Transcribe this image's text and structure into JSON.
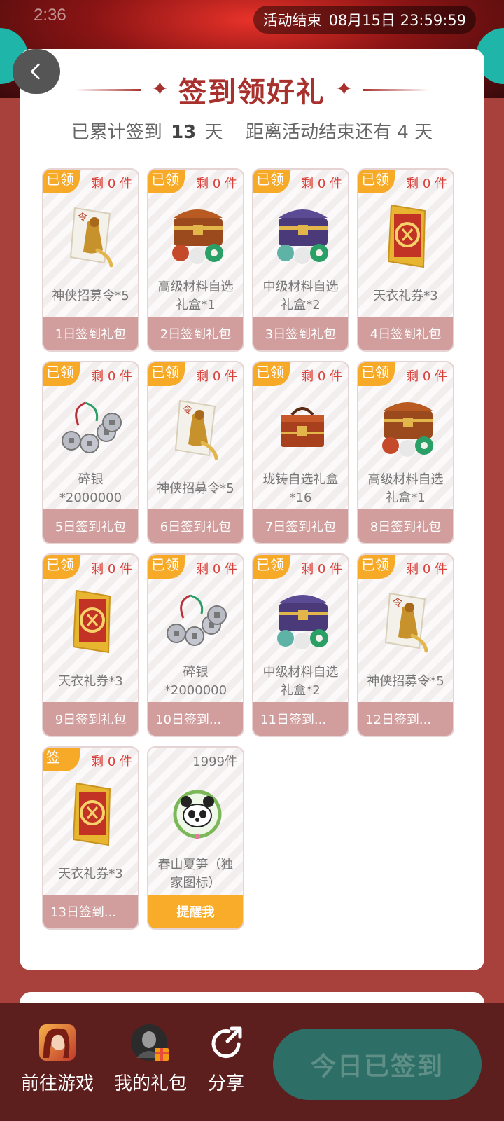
{
  "status_bar": {
    "time": "2:36"
  },
  "event_end": {
    "label": "活动结束",
    "datetime": "08月15日 23:59:59"
  },
  "header": {
    "title": "签到领好礼",
    "subtitle_prefix": "已累计签到",
    "signed_days": "13",
    "days_unit": "天",
    "remaining_prefix": "距离活动结束还有",
    "remaining_days": "4",
    "remaining_unit": "天"
  },
  "tiles": [
    {
      "corner": "已领",
      "remain": "剩 0 件",
      "name": "神侠招募令*5",
      "footer": "1日签到礼包",
      "icon": "token-icon"
    },
    {
      "corner": "已领",
      "remain": "剩 0 件",
      "name": "高级材料自选礼盒*1",
      "footer": "2日签到礼包",
      "icon": "chest-icon"
    },
    {
      "corner": "已领",
      "remain": "剩 0 件",
      "name": "中级材料自选礼盒*2",
      "footer": "3日签到礼包",
      "icon": "chest-purple-icon"
    },
    {
      "corner": "已领",
      "remain": "剩 0 件",
      "name": "天衣礼券*3",
      "footer": "4日签到礼包",
      "icon": "coupon-icon"
    },
    {
      "corner": "已领",
      "remain": "剩 0 件",
      "name": "碎银*2000000",
      "footer": "5日签到礼包",
      "icon": "coins-icon"
    },
    {
      "corner": "已领",
      "remain": "剩 0 件",
      "name": "神侠招募令*5",
      "footer": "6日签到礼包",
      "icon": "token-icon"
    },
    {
      "corner": "已领",
      "remain": "剩 0 件",
      "name": "珑铸自选礼盒*16",
      "footer": "7日签到礼包",
      "icon": "box-icon"
    },
    {
      "corner": "已领",
      "remain": "剩 0 件",
      "name": "高级材料自选礼盒*1",
      "footer": "8日签到礼包",
      "icon": "chest-icon"
    },
    {
      "corner": "已领",
      "remain": "剩 0 件",
      "name": "天衣礼券*3",
      "footer": "9日签到礼包",
      "icon": "coupon-icon"
    },
    {
      "corner": "已领",
      "remain": "剩 0 件",
      "name": "碎银*2000000",
      "footer": "10日签到...",
      "icon": "coins-icon"
    },
    {
      "corner": "已领",
      "remain": "剩 0 件",
      "name": "中级材料自选礼盒*2",
      "footer": "11日签到...",
      "icon": "chest-purple-icon"
    },
    {
      "corner": "已领",
      "remain": "剩 0 件",
      "name": "神侠招募令*5",
      "footer": "12日签到...",
      "icon": "token-icon"
    },
    {
      "corner": "签",
      "remain": "剩 0 件",
      "name": "天衣礼券*3",
      "footer": "13日签到...",
      "icon": "coupon-icon"
    },
    {
      "corner": "",
      "remain": "1999件",
      "name": "春山夏笋（独家图标）",
      "footer": "提醒我",
      "icon": "panda-icon"
    }
  ],
  "bottom_nav": {
    "game_label": "前往游戏",
    "gifts_label": "我的礼包",
    "share_label": "分享",
    "sign_button": "今日已签到"
  },
  "colors": {
    "accent": "#a8302d",
    "badge": "#f7a928",
    "footer_claimed": "#d19e9d",
    "sign_button": "#2d6e66"
  }
}
